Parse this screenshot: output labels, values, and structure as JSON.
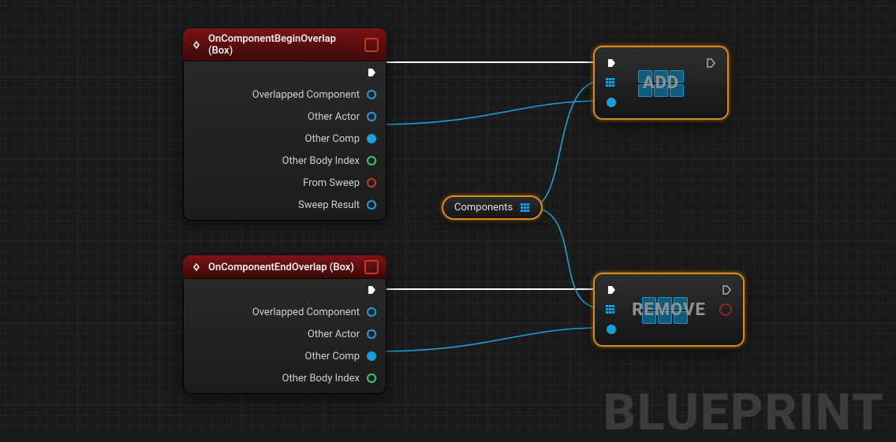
{
  "watermark": "BLUEPRINT",
  "nodes": {
    "begin": {
      "title": "OnComponentBeginOverlap (Box)",
      "pins": {
        "overlapped": "Overlapped Component",
        "otherActor": "Other Actor",
        "otherComp": "Other Comp",
        "bodyIndex": "Other Body Index",
        "fromSweep": "From Sweep",
        "sweepResult": "Sweep Result"
      }
    },
    "end": {
      "title": "OnComponentEndOverlap (Box)",
      "pins": {
        "overlapped": "Overlapped Component",
        "otherActor": "Other Actor",
        "otherComp": "Other Comp",
        "bodyIndex": "Other Body Index"
      }
    },
    "var": {
      "label": "Components"
    },
    "add": {
      "title": "ADD"
    },
    "remove": {
      "title": "REMOVE"
    }
  }
}
